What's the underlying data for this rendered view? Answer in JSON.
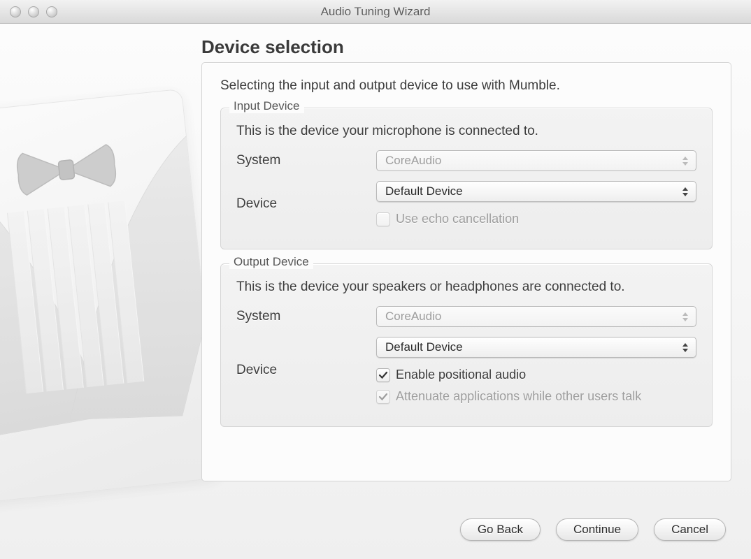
{
  "window": {
    "title": "Audio Tuning Wizard"
  },
  "page": {
    "heading": "Device selection",
    "intro": "Selecting the input and output device to use with Mumble."
  },
  "input_device": {
    "legend": "Input Device",
    "description": "This is the device your microphone is connected to.",
    "system_label": "System",
    "system_value": "CoreAudio",
    "system_enabled": false,
    "device_label": "Device",
    "device_value": "Default Device",
    "device_enabled": true,
    "echo_cancel_label": "Use echo cancellation",
    "echo_cancel_checked": false,
    "echo_cancel_enabled": false
  },
  "output_device": {
    "legend": "Output Device",
    "description": "This is the device your speakers or headphones are connected to.",
    "system_label": "System",
    "system_value": "CoreAudio",
    "system_enabled": false,
    "device_label": "Device",
    "device_value": "Default Device",
    "device_enabled": true,
    "positional_label": "Enable positional audio",
    "positional_checked": true,
    "positional_enabled": true,
    "attenuate_label": "Attenuate applications while other users talk",
    "attenuate_checked": true,
    "attenuate_enabled": false
  },
  "buttons": {
    "back": "Go Back",
    "continue": "Continue",
    "cancel": "Cancel"
  }
}
